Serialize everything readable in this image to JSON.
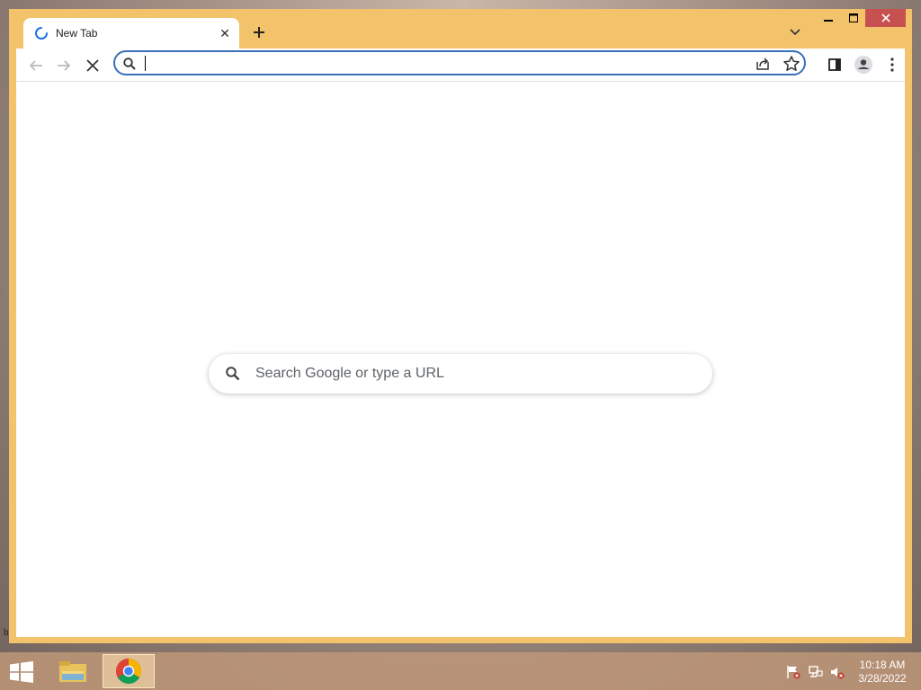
{
  "desktop": {
    "edge_label": "b"
  },
  "browser": {
    "tab": {
      "title": "New Tab",
      "close_glyph": "✕"
    },
    "new_tab_glyph": "+",
    "omnibox": {
      "value": "",
      "placeholder": ""
    },
    "ntp_search_placeholder": "Search Google or type a URL",
    "accent": "#f3c36c",
    "icons": {
      "back": "back-arrow-icon",
      "forward": "forward-arrow-icon",
      "stop": "stop-icon",
      "share": "share-icon",
      "bookmark": "star-icon",
      "side_panel": "side-panel-icon",
      "profile": "profile-icon",
      "menu": "kebab-menu-icon"
    }
  },
  "taskbar": {
    "apps": [
      "file-explorer",
      "chrome"
    ],
    "clock": {
      "time": "10:18 AM",
      "date": "3/28/2022"
    }
  }
}
